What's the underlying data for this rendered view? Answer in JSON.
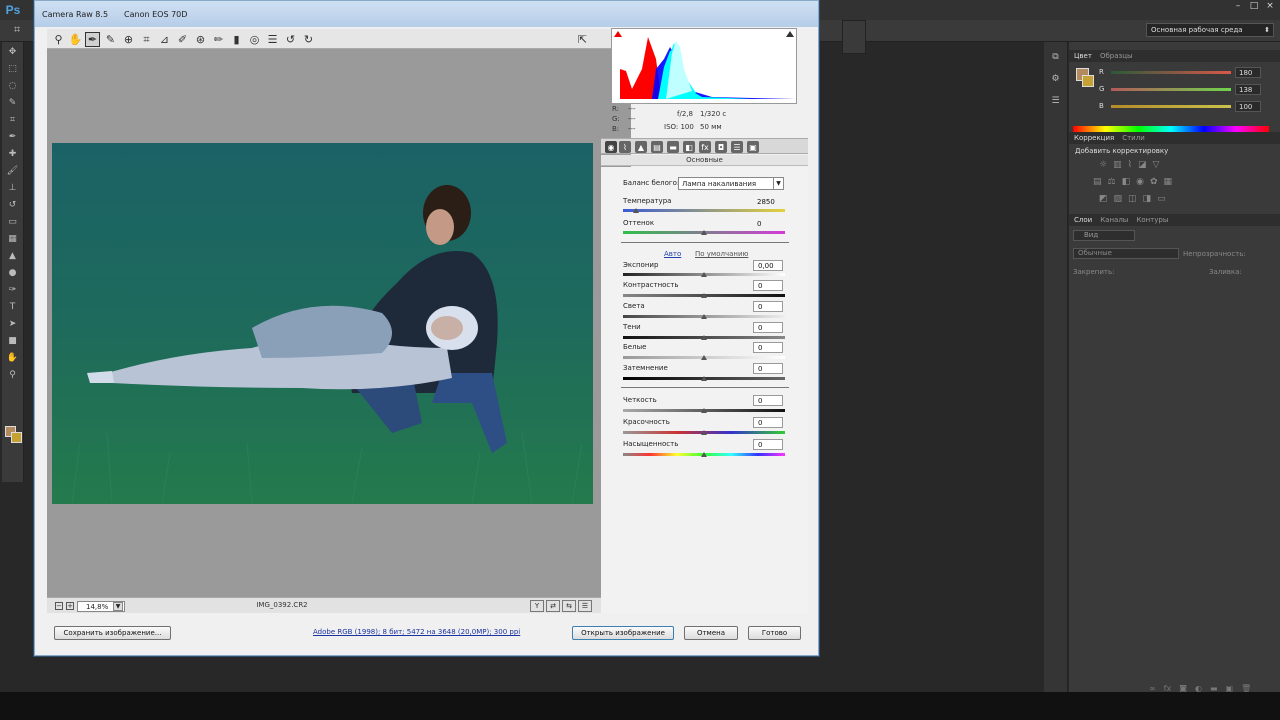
{
  "ps": {
    "logo": "Ps",
    "workspace": "Основная рабочая среда",
    "window_buttons": [
      "–",
      "□",
      "×"
    ]
  },
  "color_panel": {
    "tabs": [
      "Цвет",
      "Образцы"
    ],
    "channels": [
      {
        "label": "R",
        "value": "180",
        "color": "#d9584a"
      },
      {
        "label": "G",
        "value": "138",
        "color": "#6fd44c"
      },
      {
        "label": "B",
        "value": "100",
        "color": "#c9c24c"
      }
    ]
  },
  "adjustments_panel": {
    "tabs": [
      "Коррекция",
      "Стили"
    ],
    "heading": "Добавить корректировку"
  },
  "layers_panel": {
    "tabs": [
      "Слои",
      "Каналы",
      "Контуры"
    ],
    "filter": "Вид",
    "blend_mode": "Обычные",
    "opacity_label": "Непрозрачность:",
    "lock_label": "Закрепить:",
    "fill_label": "Заливка:"
  },
  "camera_raw": {
    "title": "Camera Raw 8.5",
    "camera": "Canon EOS 70D",
    "zoom": "14,8%",
    "filename": "IMG_0392.CR2",
    "info": {
      "r_label": "R:",
      "g_label": "G:",
      "b_label": "B:",
      "rgb_value": "---",
      "aperture": "f/2,8",
      "shutter": "1/320 с",
      "iso": "ISO: 100",
      "focal": "50 мм"
    },
    "section_title": "Основные",
    "white_balance": {
      "label": "Баланс белого:",
      "value": "Лампа накаливания"
    },
    "temperature": {
      "label": "Температура",
      "value": "2850"
    },
    "tint": {
      "label": "Оттенок",
      "value": "0"
    },
    "auto_link": "Авто",
    "default_link": "По умолчанию",
    "sliders": [
      {
        "label": "Экспонир",
        "value": "0,00"
      },
      {
        "label": "Контрастность",
        "value": "0"
      },
      {
        "label": "Света",
        "value": "0"
      },
      {
        "label": "Тени",
        "value": "0"
      },
      {
        "label": "Белые",
        "value": "0"
      },
      {
        "label": "Затемнение",
        "value": "0"
      }
    ],
    "sliders2": [
      {
        "label": "Четкость",
        "value": "0"
      },
      {
        "label": "Красочность",
        "value": "0"
      },
      {
        "label": "Насыщенность",
        "value": "0"
      }
    ],
    "save_button": "Сохранить изображение...",
    "workflow_link": "Adobe RGB (1998); 8 бит; 5472 на 3648 (20,0МР); 300 ppi",
    "open_button": "Открыть изображение",
    "cancel_button": "Отмена",
    "done_button": "Готово"
  }
}
